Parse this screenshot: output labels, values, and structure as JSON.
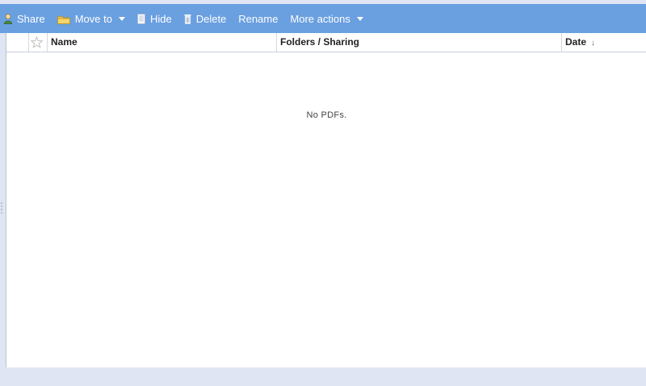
{
  "toolbar": {
    "share_label": "Share",
    "move_to_label": "Move to",
    "hide_label": "Hide",
    "delete_label": "Delete",
    "rename_label": "Rename",
    "more_actions_label": "More actions",
    "icons": {
      "share": "share-icon",
      "move_to": "folder-icon",
      "hide": "hide-icon",
      "delete": "trash-icon"
    },
    "colors": {
      "background": "#6a9fe0",
      "text": "#ffffff"
    }
  },
  "list": {
    "columns": {
      "name": "Name",
      "folders_sharing": "Folders / Sharing",
      "date": "Date",
      "date_sort_indicator": "↓"
    },
    "empty_message": "No PDFs."
  },
  "colors": {
    "page_background": "#dfe5f2",
    "list_background": "#ffffff"
  }
}
